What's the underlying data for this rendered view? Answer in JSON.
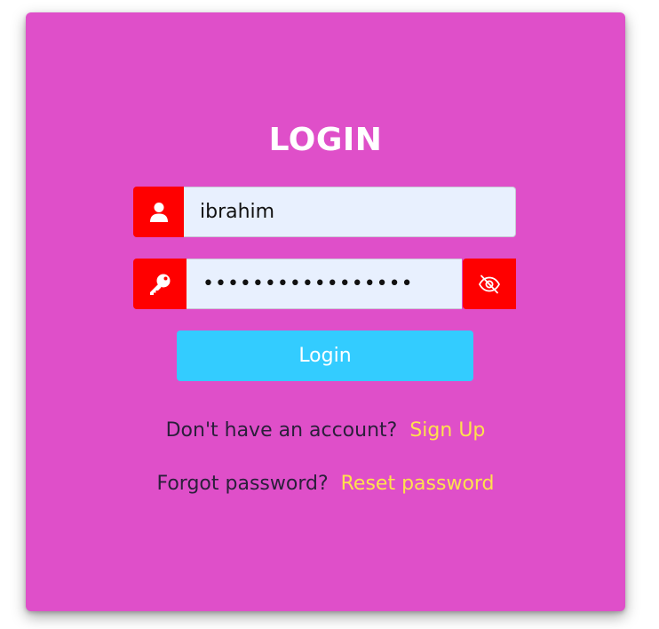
{
  "colors": {
    "card_background": "#df4fc9",
    "icon_addon": "#ff0000",
    "input_background": "#e8f0fe",
    "button": "#33ccff",
    "link": "#ffe14d",
    "title": "#ffffff"
  },
  "login_form": {
    "title": "LOGIN",
    "username": {
      "icon": "user-icon",
      "value": "ibrahim"
    },
    "password": {
      "icon": "key-icon",
      "value": "•••••••••••••••••",
      "toggle_icon": "eye-slash-icon"
    },
    "submit_label": "Login",
    "signup_prompt": "Don't have an account?",
    "signup_link": "Sign Up",
    "forgot_prompt": "Forgot password?",
    "reset_link": "Reset password"
  }
}
